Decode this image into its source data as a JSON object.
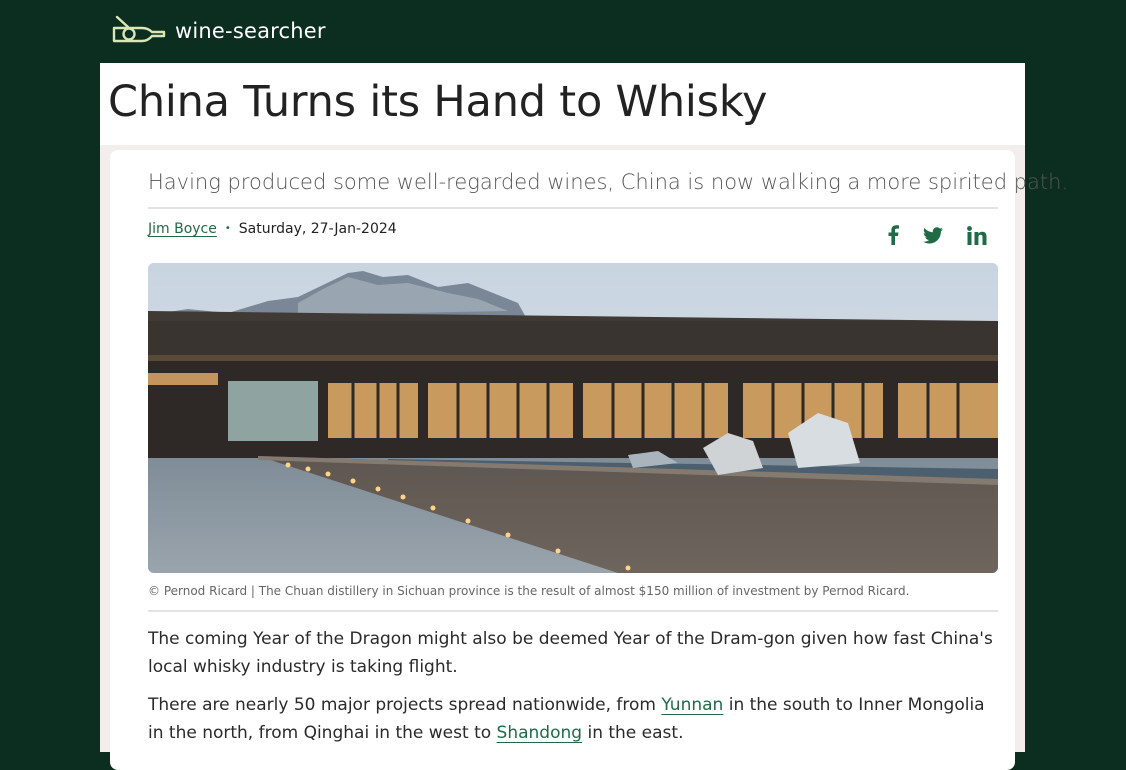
{
  "site": {
    "name": "wine-searcher",
    "logo_icon": "wine-bottle-magnifier-icon",
    "brand_color": "#0c2e20",
    "accent_color": "#1f6b45"
  },
  "article": {
    "title": "China Turns its Hand to Whisky",
    "subtitle": "Having produced some well-regarded wines, China is now walking a more spirited path.",
    "author": "Jim Boyce",
    "separator": "•",
    "date": "Saturday, 27-Jan-2024",
    "share": [
      {
        "name": "facebook",
        "icon": "facebook-icon"
      },
      {
        "name": "twitter",
        "icon": "twitter-icon"
      },
      {
        "name": "linkedin",
        "icon": "linkedin-icon"
      }
    ],
    "image_caption": "© Pernod Ricard | The Chuan distillery in Sichuan province is the result of almost $150 million of investment by Pernod Ricard.",
    "paragraphs": [
      {
        "text": "The coming Year of the Dragon might also be deemed Year of the Dram-gon given how fast China's local whisky industry is taking flight."
      },
      {
        "before_link1": "There are nearly 50 major projects spread nationwide, from ",
        "link1": "Yunnan",
        "between_links": " in the south to Inner Mongolia in the north, from Qinghai in the west to ",
        "link2": "Shandong",
        "after_link2": " in the east."
      }
    ]
  }
}
